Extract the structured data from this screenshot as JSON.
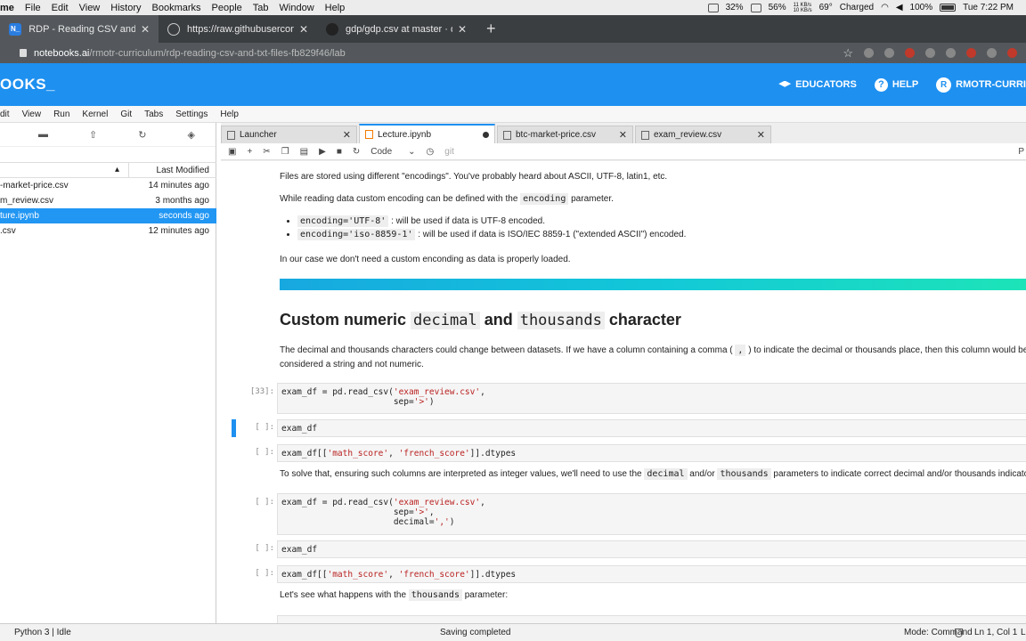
{
  "menubar": {
    "app": "me",
    "items": [
      "File",
      "Edit",
      "View",
      "History",
      "Bookmarks",
      "People",
      "Tab",
      "Window",
      "Help"
    ],
    "cpu": "32%",
    "mem": "56%",
    "net_up": "11 KB/s",
    "net_down": "10 KB/s",
    "temp": "69°",
    "charge": "Charged",
    "battery": "100%",
    "clock": "Tue 7:22 PM"
  },
  "browser": {
    "tabs": [
      {
        "label": "RDP - Reading CSV and TXT Files",
        "favicon": "N_"
      },
      {
        "label": "https://raw.githubusercontent.com",
        "favicon": "globe-icon"
      },
      {
        "label": "gdp/gdp.csv at master · datasets",
        "favicon": "github-icon"
      }
    ],
    "url_host": "notebooks.ai",
    "url_path": "/rmotr-curriculum/rdp-reading-csv-and-txt-files-fb829f46/lab"
  },
  "header": {
    "logo": "OOKS_",
    "educators": "EDUCATORS",
    "help": "HELP",
    "user": "RMOTR-CURRI",
    "avatar": "R"
  },
  "jupyter_menu": [
    "dit",
    "View",
    "Run",
    "Kernel",
    "Git",
    "Tabs",
    "Settings",
    "Help"
  ],
  "filebrowser": {
    "col_modified": "Last Modified",
    "files": [
      {
        "name": "-market-price.csv",
        "modified": "14 minutes ago"
      },
      {
        "name": "m_review.csv",
        "modified": "3 months ago"
      },
      {
        "name": "ture.ipynb",
        "modified": "seconds ago"
      },
      {
        "name": ".csv",
        "modified": "12 minutes ago"
      }
    ]
  },
  "doc_tabs": [
    {
      "label": "Launcher"
    },
    {
      "label": "Lecture.ipynb"
    },
    {
      "label": "btc-market-price.csv"
    },
    {
      "label": "exam_review.csv"
    }
  ],
  "toolbar": {
    "cell_type": "Code",
    "git": "git",
    "kernel_letter": "P"
  },
  "notebook": {
    "p1": "Files are stored using different \"encodings\". You've probably heard about ASCII, UTF-8, latin1, etc.",
    "p2_a": "While reading data custom encoding can be defined with the ",
    "p2_code": "encoding",
    "p2_b": " parameter.",
    "li1_code": "encoding='UTF-8'",
    "li1_text": " : will be used if data is UTF-8 encoded.",
    "li2_code": "encoding='iso-8859-1'",
    "li2_text": " : will be used if data is ISO/IEC 8859-1 (\"extended ASCII\") encoded.",
    "p3": "In our case we don't need a custom enconding as data is properly loaded.",
    "h_a": "Custom numeric ",
    "h_code1": "decimal",
    "h_b": " and ",
    "h_code2": "thousands",
    "h_c": " character",
    "p4_a": "The decimal and thousands characters could change between datasets. If we have a column containing a comma ( ",
    "p4_code": ",",
    "p4_b": " ) to indicate the decimal or thousands place, then this column would be",
    "p4_line2": "considered a string and not numeric.",
    "prompt1": "[33]:",
    "cell1_l1a": "exam_df = pd.read_csv(",
    "cell1_l1s": "'exam_review.csv'",
    "cell1_l1b": ",",
    "cell1_l2a": "                      sep=",
    "cell1_l2s": "'>'",
    "cell1_l2b": ")",
    "prompt_empty": "[ ]:",
    "cell2": "exam_df",
    "cell3_a": "exam_df[[",
    "cell3_s1": "'math_score'",
    "cell3_b": ", ",
    "cell3_s2": "'french_score'",
    "cell3_c": "]].dtypes",
    "p5_a": "To solve that, ensuring such columns are interpreted as integer values, we'll need to use the ",
    "p5_code1": "decimal",
    "p5_b": " and/or ",
    "p5_code2": "thousands",
    "p5_c": " parameters to indicate correct decimal and/or thousands indicators",
    "cell4_l1a": "exam_df = pd.read_csv(",
    "cell4_l1s": "'exam_review.csv'",
    "cell4_l1b": ",",
    "cell4_l2a": "                      sep=",
    "cell4_l2s": "'>'",
    "cell4_l2b": ",",
    "cell4_l3a": "                      decimal=",
    "cell4_l3s": "','",
    "cell4_l3b": ")",
    "cell5": "exam_df",
    "cell6_a": "exam_df[[",
    "cell6_s1": "'math_score'",
    "cell6_b": ", ",
    "cell6_s2": "'french_score'",
    "cell6_c": "]].dtypes",
    "p6_a": "Let's see what happens with the ",
    "p6_code": "thousands",
    "p6_b": " parameter:"
  },
  "status": {
    "kernel": "Python 3 | Idle",
    "saving": "Saving completed",
    "mode": "Mode: Command",
    "position": "Ln 1, Col 1",
    "l": "L"
  }
}
